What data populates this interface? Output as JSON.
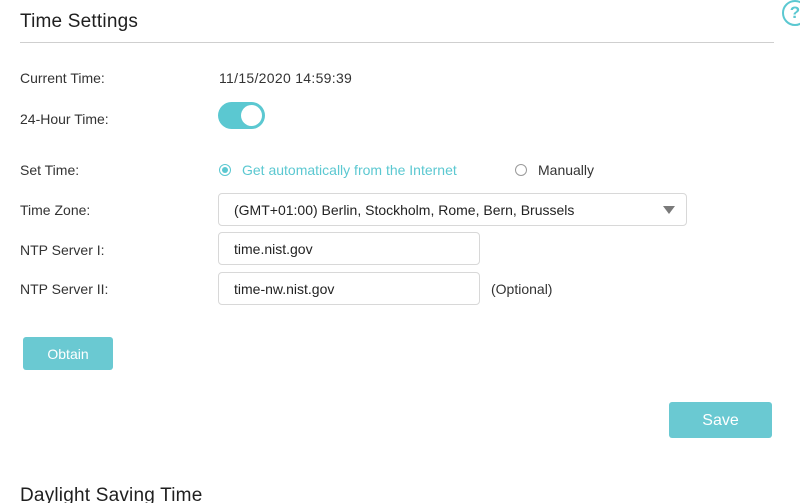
{
  "header": {
    "title": "Time Settings",
    "help_icon": "?"
  },
  "fields": {
    "current_time": {
      "label": "Current Time:",
      "value": "11/15/2020 14:59:39"
    },
    "hour_24": {
      "label": "24-Hour Time:",
      "enabled": true
    },
    "set_time": {
      "label": "Set Time:",
      "options": [
        {
          "label": "Get automatically from the Internet",
          "selected": true
        },
        {
          "label": "Manually",
          "selected": false
        }
      ]
    },
    "time_zone": {
      "label": "Time Zone:",
      "selected": "(GMT+01:00) Berlin, Stockholm, Rome, Bern, Brussels"
    },
    "ntp1": {
      "label": "NTP Server I:",
      "value": "time.nist.gov"
    },
    "ntp2": {
      "label": "NTP Server II:",
      "value": "time-nw.nist.gov",
      "note": "(Optional)"
    }
  },
  "buttons": {
    "obtain": "Obtain",
    "save": "Save"
  },
  "next_section": {
    "title": "Daylight Saving Time"
  },
  "colors": {
    "accent": "#5bc8d1",
    "button": "#6ac9d2"
  }
}
